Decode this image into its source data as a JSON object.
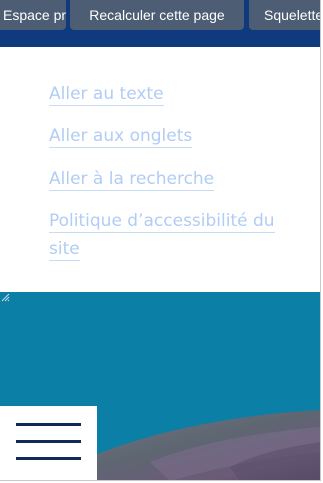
{
  "admin_bar": {
    "buttons": [
      {
        "label": "Espace privé"
      },
      {
        "label": "Recalculer cette page"
      },
      {
        "label": "Squelette"
      }
    ]
  },
  "skip_links": {
    "items": [
      {
        "label": "Aller au texte"
      },
      {
        "label": "Aller aux onglets"
      },
      {
        "label": "Aller à la recherche"
      },
      {
        "label": "Politique d’accessibilité du site"
      }
    ]
  },
  "hero": {
    "menu_toggle_icon": "hamburger-menu-icon"
  },
  "colors": {
    "admin_bar_bg": "#0f3a7e",
    "admin_button_bg": "#4d5d74",
    "skip_link_text": "#b1ccf5",
    "hero_bg": "#0b7fa6",
    "menu_bar": "#0f2a5a"
  }
}
